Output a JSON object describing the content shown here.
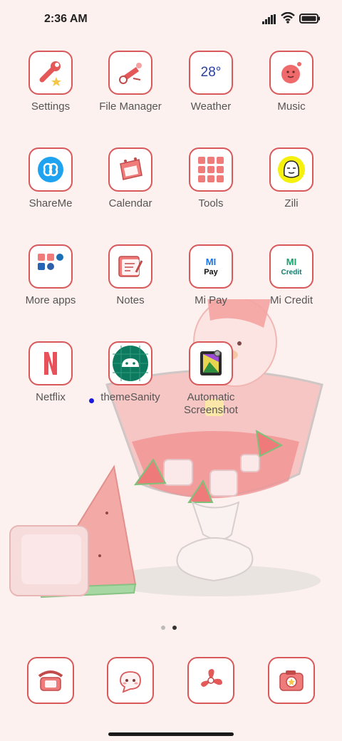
{
  "status_bar": {
    "time": "2:36 AM"
  },
  "apps": [
    {
      "label": "Settings",
      "icon": "settings-icon"
    },
    {
      "label": "File Manager",
      "icon": "file-manager-icon"
    },
    {
      "label": "Weather",
      "icon": "weather-icon",
      "icon_text": "28°"
    },
    {
      "label": "Music",
      "icon": "music-icon"
    },
    {
      "label": "ShareMe",
      "icon": "shareme-icon"
    },
    {
      "label": "Calendar",
      "icon": "calendar-icon"
    },
    {
      "label": "Tools",
      "icon": "tools-folder-icon"
    },
    {
      "label": "Zili",
      "icon": "zili-icon"
    },
    {
      "label": "More apps",
      "icon": "more-apps-folder-icon"
    },
    {
      "label": "Notes",
      "icon": "notes-icon"
    },
    {
      "label": "Mi Pay",
      "icon": "mi-pay-icon",
      "icon_text": "Pay"
    },
    {
      "label": "Mi Credit",
      "icon": "mi-credit-icon",
      "icon_text": "Credit"
    },
    {
      "label": "Netflix",
      "icon": "netflix-icon",
      "icon_text": "N"
    },
    {
      "label": "themeSanity",
      "icon": "android-icon"
    },
    {
      "label": "Automatic Screenshot",
      "icon": "screenshot-icon"
    }
  ],
  "dock": [
    {
      "icon": "phone-icon"
    },
    {
      "icon": "messages-icon"
    },
    {
      "icon": "fan-icon"
    },
    {
      "icon": "camera-icon"
    }
  ],
  "pager": {
    "pages": 2,
    "current": 2
  },
  "colors": {
    "accent": "#d9585a",
    "background": "#fdf1ef"
  }
}
